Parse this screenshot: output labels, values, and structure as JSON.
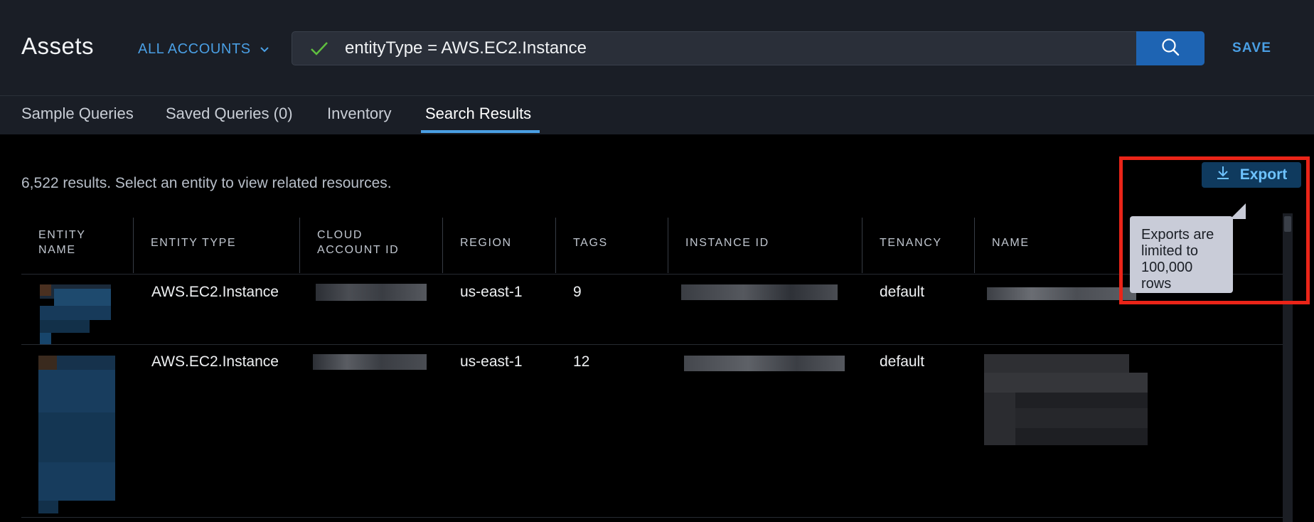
{
  "header": {
    "title": "Assets",
    "account_selector": "ALL ACCOUNTS",
    "search_query": "entityType = AWS.EC2.Instance",
    "save_label": "SAVE"
  },
  "tabs": [
    {
      "label": "Sample Queries"
    },
    {
      "label": "Saved Queries (0)"
    },
    {
      "label": "Inventory"
    },
    {
      "label": "Search Results",
      "active": true
    }
  ],
  "results": {
    "summary": "6,522 results. Select an entity to view related resources.",
    "export_label": "Export",
    "export_tooltip": "Exports are limited to 100,000 rows"
  },
  "table": {
    "columns": [
      "ENTITY NAME",
      "ENTITY TYPE",
      "CLOUD ACCOUNT ID",
      "REGION",
      "TAGS",
      "INSTANCE ID",
      "TENANCY",
      "NAME"
    ],
    "rows": [
      {
        "entity_type": "AWS.EC2.Instance",
        "region": "us-east-1",
        "tags": "9",
        "tenancy": "default"
      },
      {
        "entity_type": "AWS.EC2.Instance",
        "region": "us-east-1",
        "tags": "12",
        "tenancy": "default"
      }
    ]
  },
  "icons": {
    "valid": "check-icon",
    "dropdown": "chevron-down-icon",
    "search": "search-icon",
    "download": "download-icon"
  },
  "colors": {
    "accent": "#4a9fe4",
    "highlight": "#ea2418",
    "header_bg": "#1a1e26",
    "search_button": "#1e64b3"
  }
}
